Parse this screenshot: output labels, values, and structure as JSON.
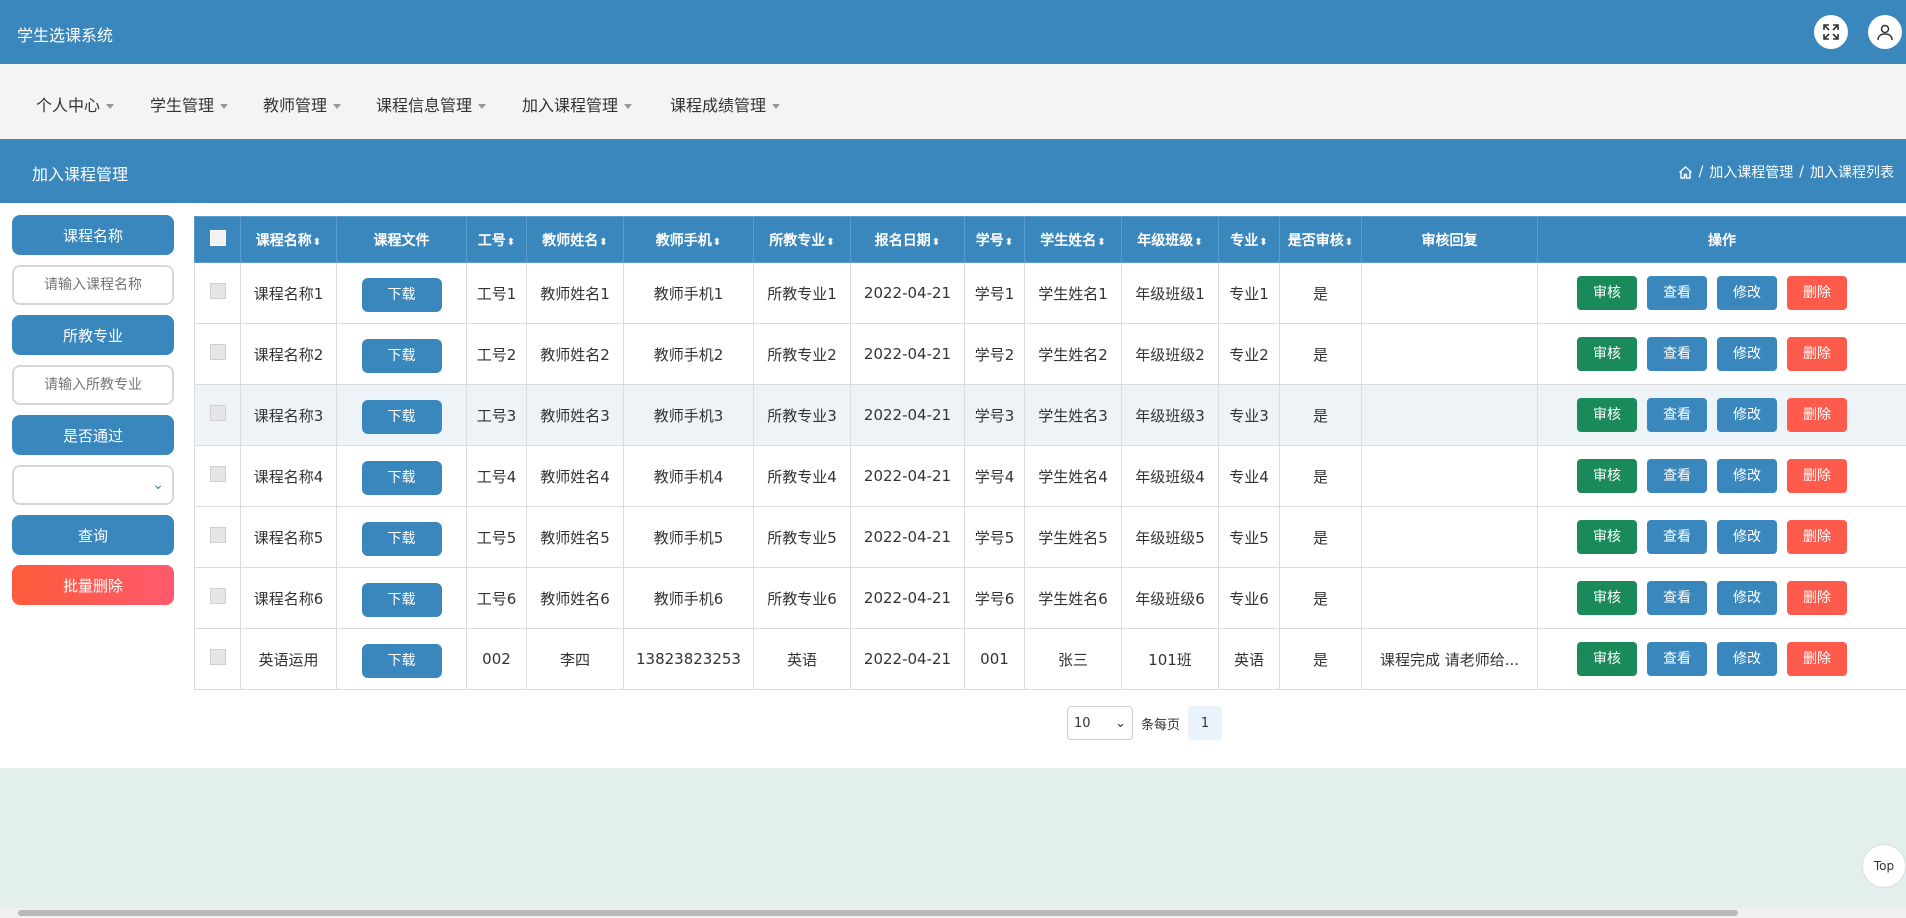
{
  "app": {
    "title": "学生选课系统"
  },
  "nav": [
    {
      "label": "个人中心"
    },
    {
      "label": "学生管理"
    },
    {
      "label": "教师管理"
    },
    {
      "label": "课程信息管理"
    },
    {
      "label": "加入课程管理"
    },
    {
      "label": "课程成绩管理"
    }
  ],
  "page": {
    "title": "加入课程管理",
    "breadcrumb": [
      "加入课程管理",
      "加入课程列表"
    ],
    "separator": "/"
  },
  "sidebar": {
    "course_label": "课程名称",
    "course_placeholder": "请输入课程名称",
    "major_label": "所教专业",
    "major_placeholder": "请输入所教专业",
    "passed_label": "是否通过",
    "query_label": "查询",
    "batch_delete_label": "批量删除"
  },
  "table": {
    "headers": [
      "课程名称",
      "课程文件",
      "工号",
      "教师姓名",
      "教师手机",
      "所教专业",
      "报名日期",
      "学号",
      "学生姓名",
      "年级班级",
      "专业",
      "是否审核",
      "审核回复",
      "操作"
    ],
    "sort_glyph": "⬍",
    "download_label": "下载",
    "actions": {
      "audit": "审核",
      "view": "查看",
      "edit": "修改",
      "delete": "删除"
    },
    "rows": [
      {
        "course": "课程名称1",
        "job_no": "工号1",
        "teacher": "教师姓名1",
        "phone": "教师手机1",
        "major_taught": "所教专业1",
        "date": "2022-04-21",
        "student_no": "学号1",
        "student": "学生姓名1",
        "grade": "年级班级1",
        "major": "专业1",
        "audited": "是",
        "reply": ""
      },
      {
        "course": "课程名称2",
        "job_no": "工号2",
        "teacher": "教师姓名2",
        "phone": "教师手机2",
        "major_taught": "所教专业2",
        "date": "2022-04-21",
        "student_no": "学号2",
        "student": "学生姓名2",
        "grade": "年级班级2",
        "major": "专业2",
        "audited": "是",
        "reply": ""
      },
      {
        "course": "课程名称3",
        "job_no": "工号3",
        "teacher": "教师姓名3",
        "phone": "教师手机3",
        "major_taught": "所教专业3",
        "date": "2022-04-21",
        "student_no": "学号3",
        "student": "学生姓名3",
        "grade": "年级班级3",
        "major": "专业3",
        "audited": "是",
        "reply": ""
      },
      {
        "course": "课程名称4",
        "job_no": "工号4",
        "teacher": "教师姓名4",
        "phone": "教师手机4",
        "major_taught": "所教专业4",
        "date": "2022-04-21",
        "student_no": "学号4",
        "student": "学生姓名4",
        "grade": "年级班级4",
        "major": "专业4",
        "audited": "是",
        "reply": ""
      },
      {
        "course": "课程名称5",
        "job_no": "工号5",
        "teacher": "教师姓名5",
        "phone": "教师手机5",
        "major_taught": "所教专业5",
        "date": "2022-04-21",
        "student_no": "学号5",
        "student": "学生姓名5",
        "grade": "年级班级5",
        "major": "专业5",
        "audited": "是",
        "reply": ""
      },
      {
        "course": "课程名称6",
        "job_no": "工号6",
        "teacher": "教师姓名6",
        "phone": "教师手机6",
        "major_taught": "所教专业6",
        "date": "2022-04-21",
        "student_no": "学号6",
        "student": "学生姓名6",
        "grade": "年级班级6",
        "major": "专业6",
        "audited": "是",
        "reply": ""
      },
      {
        "course": "英语运用",
        "job_no": "002",
        "teacher": "李四",
        "phone": "13823823253",
        "major_taught": "英语",
        "date": "2022-04-21",
        "student_no": "001",
        "student": "张三",
        "grade": "101班",
        "major": "英语",
        "audited": "是",
        "reply": "课程完成 请老师给..."
      }
    ]
  },
  "pager": {
    "page_size": "10",
    "per_page_label": "条每页",
    "current_page": "1"
  },
  "misc": {
    "top_label": "Top"
  },
  "colors": {
    "primary": "#3a87bd",
    "audit": "#1b8a5a",
    "danger": "#ff5b4d"
  },
  "icons": {
    "fullscreen": "expand-icon",
    "user": "user-icon",
    "home": "home-icon",
    "select": "chevron-down-icon"
  }
}
